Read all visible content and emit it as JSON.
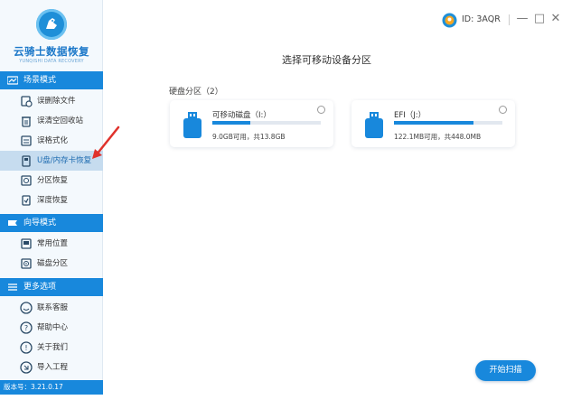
{
  "sidebar": {
    "logo_title": "云骑士数据恢复",
    "logo_subtitle": "YUNQISHI DATA RECOVERY",
    "sections": [
      {
        "title": "场景模式",
        "icon": "scene-mode-icon"
      },
      {
        "title": "向导模式",
        "icon": "wizard-mode-icon"
      },
      {
        "title": "更多选项",
        "icon": "menu-icon"
      }
    ],
    "scene_items": [
      {
        "label": "误删除文件",
        "icon": "deleted-file-icon"
      },
      {
        "label": "误清空回收站",
        "icon": "recycle-bin-icon"
      },
      {
        "label": "误格式化",
        "icon": "format-icon"
      },
      {
        "label": "U盘/内存卡恢复",
        "icon": "usb-card-icon"
      },
      {
        "label": "分区恢复",
        "icon": "partition-icon"
      },
      {
        "label": "深度恢复",
        "icon": "deep-recovery-icon"
      }
    ],
    "wizard_items": [
      {
        "label": "常用位置",
        "icon": "common-location-icon"
      },
      {
        "label": "磁盘分区",
        "icon": "disk-partition-icon"
      }
    ],
    "more_items": [
      {
        "label": "联系客服",
        "icon": "customer-service-icon"
      },
      {
        "label": "帮助中心",
        "icon": "help-icon"
      },
      {
        "label": "关于我们",
        "icon": "about-icon"
      },
      {
        "label": "导入工程",
        "icon": "import-icon"
      }
    ],
    "version": "版本号：3.21.0.17"
  },
  "titlebar": {
    "id_text": "ID: 3AQR",
    "minimize": "—",
    "maximize": "□",
    "close": "✕"
  },
  "main": {
    "title": "选择可移动设备分区",
    "section_label": "硬盘分区（2）",
    "devices": [
      {
        "name": "可移动磁盘（I:）",
        "info": "9.0GB可用，共13.8GB",
        "used_fraction": 0.35
      },
      {
        "name": "EFI（J:）",
        "info": "122.1MB可用，共448.0MB",
        "used_fraction": 0.73
      }
    ],
    "start_button": "开始扫描"
  },
  "colors": {
    "accent": "#1888dc",
    "sidebar_bg": "#f4f9fd",
    "active_item_bg": "#c6dcef",
    "annotation_arrow": "#e0322c"
  }
}
